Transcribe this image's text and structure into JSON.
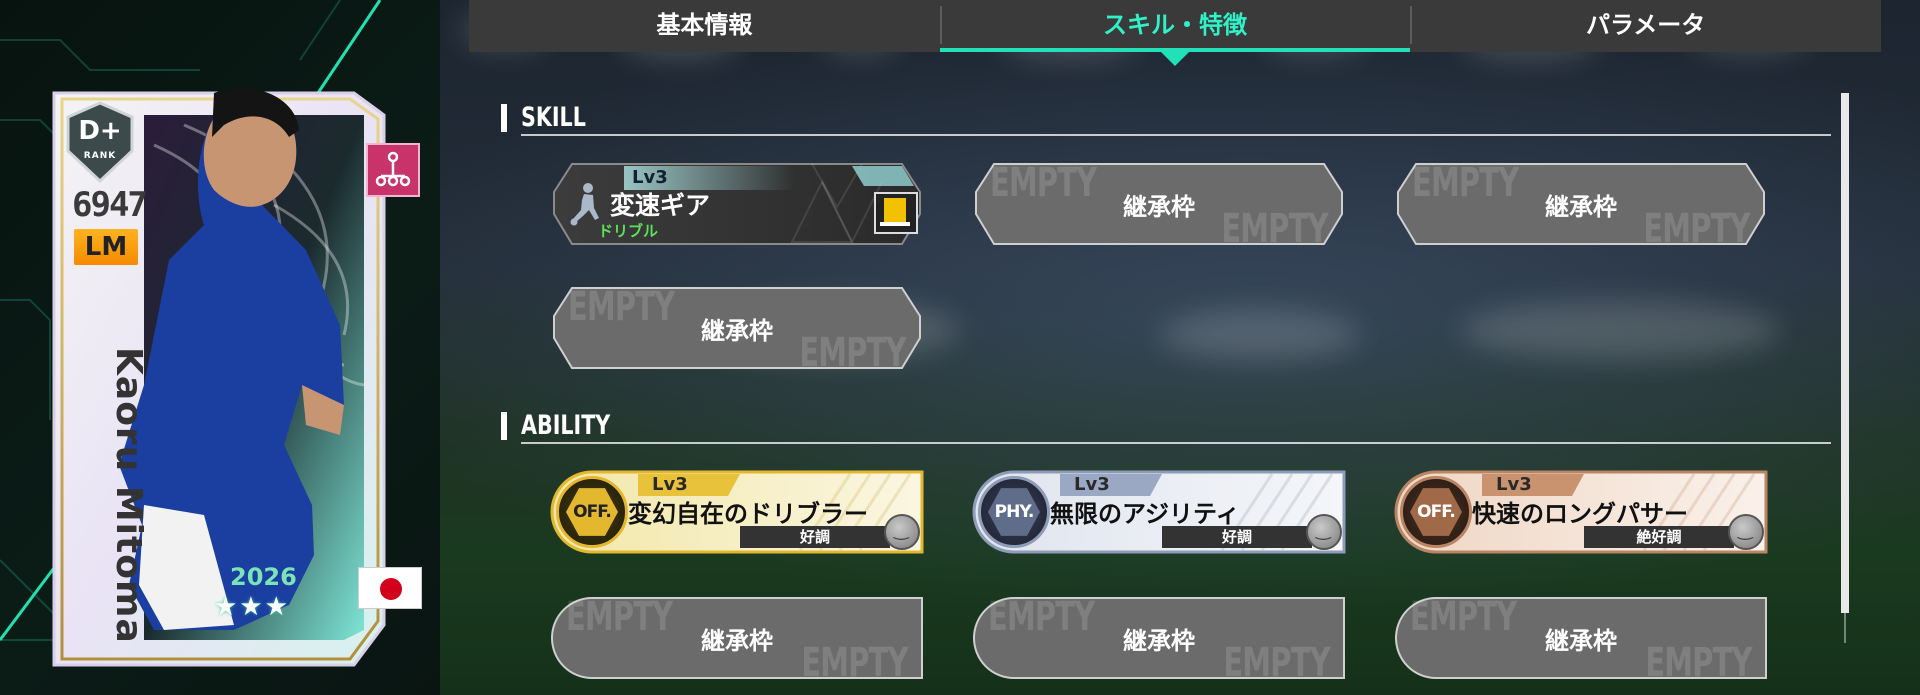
{
  "tabs": [
    {
      "label": "基本情報",
      "active": false
    },
    {
      "label": "スキル・特徴",
      "active": true
    },
    {
      "label": "パラメータ",
      "active": false
    }
  ],
  "card": {
    "rank": "D+",
    "rank_sub": "RANK",
    "overall": "6947",
    "position": "LM",
    "player_name": "Kaoru Mitoma",
    "card_type": "SPECIAL STAR",
    "season": "2026",
    "stars": "★★★",
    "nationality": "Japan"
  },
  "skill_section": {
    "title": "SKILL",
    "slots": [
      {
        "type": "filled",
        "level": "Lv3",
        "name": "変速ギア",
        "category": "ドリブル",
        "icon": "dribble-player-icon"
      },
      {
        "type": "empty",
        "label": "継承枠",
        "watermark": "EMPTY"
      },
      {
        "type": "empty",
        "label": "継承枠",
        "watermark": "EMPTY"
      },
      {
        "type": "empty",
        "label": "継承枠",
        "watermark": "EMPTY"
      }
    ]
  },
  "ability_section": {
    "title": "ABILITY",
    "slots": [
      {
        "type": "filled",
        "tier": "gold",
        "emblem": "OFF.",
        "level": "Lv3",
        "name": "変幻自在のドリブラー",
        "condition": "好調"
      },
      {
        "type": "filled",
        "tier": "silver",
        "emblem": "PHY.",
        "level": "Lv3",
        "name": "無限のアジリティ",
        "condition": "好調"
      },
      {
        "type": "filled",
        "tier": "bronze",
        "emblem": "OFF.",
        "level": "Lv3",
        "name": "快速のロングパサー",
        "condition": "絶好調"
      },
      {
        "type": "empty",
        "label": "継承枠",
        "watermark": "EMPTY"
      },
      {
        "type": "empty",
        "label": "継承枠",
        "watermark": "EMPTY"
      },
      {
        "type": "empty",
        "label": "継承枠",
        "watermark": "EMPTY"
      }
    ]
  },
  "colors": {
    "accent": "#22e0b8",
    "position_badge": "#f59a00",
    "gold": "#e8c23a",
    "silver": "#9aa8c4",
    "bronze": "#c99370"
  }
}
